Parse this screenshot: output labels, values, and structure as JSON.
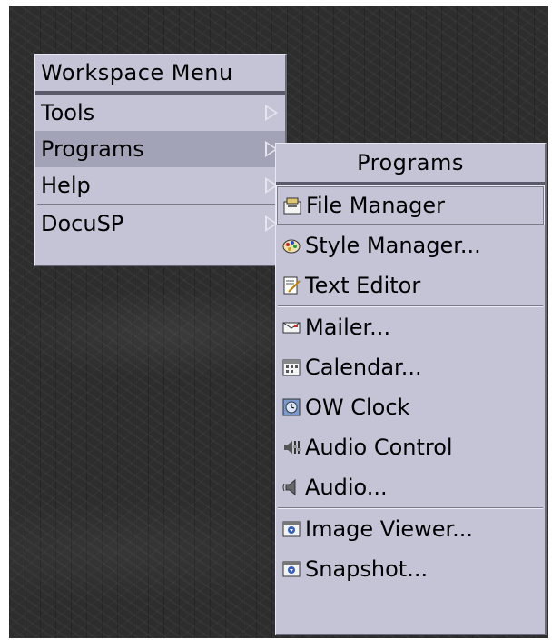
{
  "workspace_menu": {
    "title": "Workspace Menu",
    "items": [
      {
        "label": "Tools"
      },
      {
        "label": "Programs"
      },
      {
        "label": "Help"
      },
      {
        "label": "DocuSP"
      }
    ]
  },
  "programs_menu": {
    "title": "Programs",
    "items": [
      {
        "label": "File Manager",
        "icon": "file-manager-icon"
      },
      {
        "label": "Style Manager...",
        "icon": "style-manager-icon"
      },
      {
        "label": "Text Editor",
        "icon": "text-editor-icon"
      },
      {
        "label": "Mailer...",
        "icon": "mailer-icon"
      },
      {
        "label": "Calendar...",
        "icon": "calendar-icon"
      },
      {
        "label": "OW Clock",
        "icon": "clock-icon"
      },
      {
        "label": "Audio Control",
        "icon": "audio-control-icon"
      },
      {
        "label": "Audio...",
        "icon": "audio-icon"
      },
      {
        "label": "Image Viewer...",
        "icon": "image-viewer-icon"
      },
      {
        "label": "Snapshot...",
        "icon": "snapshot-icon"
      }
    ]
  }
}
